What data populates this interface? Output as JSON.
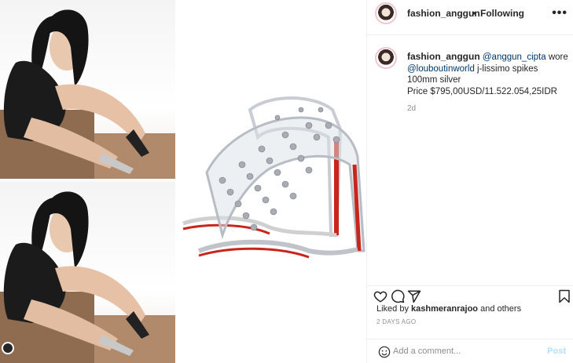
{
  "header": {
    "username": "fashion_anggun",
    "separator": "•",
    "follow_status": "Following",
    "more_icon": "more-horizontal-icon"
  },
  "caption": {
    "username": "fashion_anggun",
    "mention_1": "@anggun_cipta",
    "text_1": "wore",
    "mention_2": "@louboutinworld",
    "text_2": "j-lissimo spikes 100mm silver",
    "price": "Price $795,00USD/11.522.054,25IDR",
    "time": "2d"
  },
  "actions": {
    "like_icon": "heart-icon",
    "comment_icon": "comment-icon",
    "share_icon": "send-icon",
    "save_icon": "bookmark-icon"
  },
  "likes": {
    "prefix": "Liked by",
    "user": "kashmeranrajoo",
    "suffix": "and others"
  },
  "date": "2 DAYS AGO",
  "comment": {
    "placeholder": "Add a comment...",
    "post_label": "Post",
    "emoji_icon": "smiley-icon"
  },
  "colors": {
    "link": "#00376b",
    "muted": "#8e8e8e",
    "post_disabled": "#b2dffc",
    "sole_red": "#c8261c"
  }
}
